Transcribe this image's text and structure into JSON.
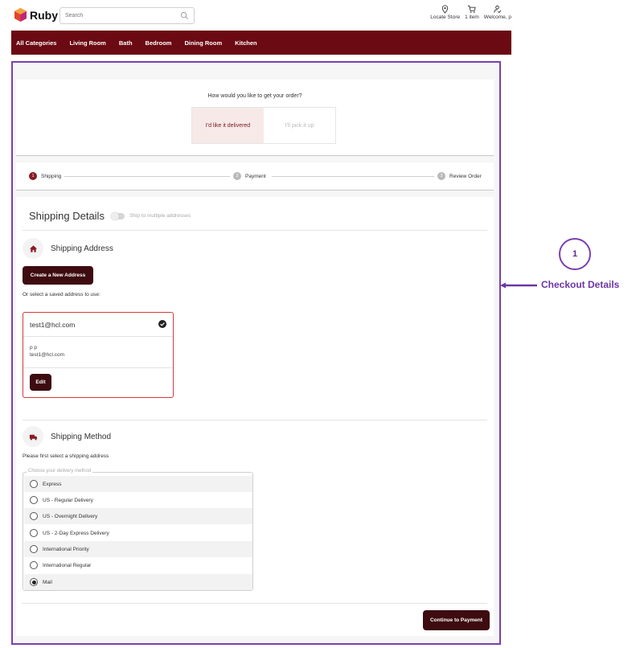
{
  "header": {
    "brand": "Ruby",
    "search_placeholder": "Search",
    "locate_store": "Locate Store",
    "cart": "1 item",
    "welcome": "Welcome, p"
  },
  "nav": {
    "items": [
      "All Categories",
      "Living Room",
      "Bath",
      "Bedroom",
      "Dining Room",
      "Kitchen"
    ]
  },
  "delivery": {
    "question": "How would you like to get your order?",
    "options": [
      "I'd like it delivered",
      "I'll pick it up"
    ],
    "selected": "I'd like it delivered"
  },
  "steps": [
    {
      "num": "1",
      "label": "Shipping",
      "active": true
    },
    {
      "num": "2",
      "label": "Payment",
      "active": false
    },
    {
      "num": "3",
      "label": "Review Order",
      "active": false
    }
  ],
  "shipping_details": {
    "title": "Shipping Details",
    "toggle_label": "Ship to multiple addresses",
    "address_section_title": "Shipping Address",
    "create_button": "Create a New Address",
    "saved_address_prompt": "Or select a saved address to use:",
    "address": {
      "nickname": "test1@hcl.com",
      "name": "p p",
      "email": "test1@hcl.com",
      "edit_button": "Edit"
    }
  },
  "shipping_method": {
    "title": "Shipping Method",
    "note": "Please first select a shipping address",
    "legend": "Choose your delivery method",
    "options": [
      "Express",
      "US - Regular Delivery",
      "US - Overnight Delivery",
      "US - 2-Day Express Delivery",
      "International Priority",
      "International Regular",
      "Mail"
    ],
    "selected": "Mail"
  },
  "continue_button": "Continue to Payment",
  "annotation": {
    "number": "1",
    "label": "Checkout Details"
  },
  "colors": {
    "brand": "#6b0a12",
    "button_dark": "#3d0b10",
    "annotation": "#7b3fb0"
  }
}
